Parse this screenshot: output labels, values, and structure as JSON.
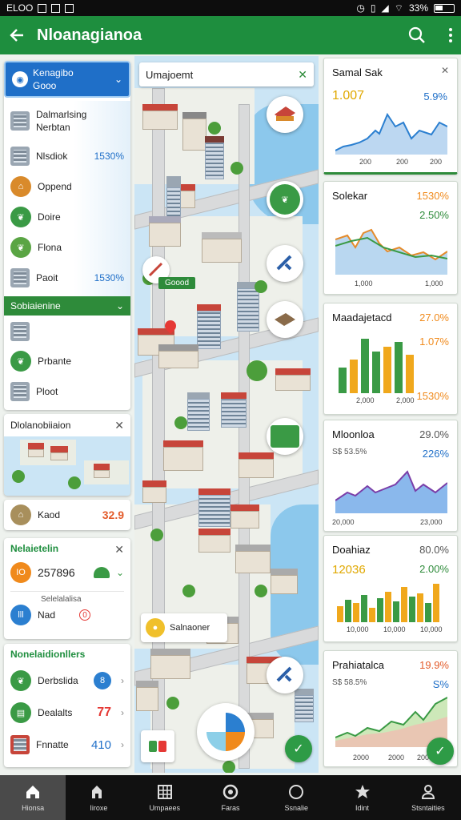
{
  "status_bar": {
    "left_text": "ELOO",
    "battery": "33%"
  },
  "app_bar": {
    "title": "Nloanagianoa"
  },
  "left": {
    "dropdown": {
      "line1": "Kenagibo",
      "line2": "Gooo"
    },
    "list1": [
      {
        "icon": "building-icon",
        "label": "Dalmarlsing\nNerbtan",
        "value": ""
      },
      {
        "icon": "building-icon",
        "label": "Nlsdiok",
        "value": "1530%"
      },
      {
        "icon": "temple-icon",
        "label": "Oppend",
        "value": ""
      },
      {
        "icon": "leaf-icon",
        "label": "Doire",
        "value": ""
      },
      {
        "icon": "leaf-icon",
        "label": "Flona",
        "value": ""
      },
      {
        "icon": "building-icon",
        "label": "Paoit",
        "value": "1530%"
      }
    ],
    "section2_title": "Sobiaienine",
    "list2": [
      {
        "icon": "building-icon",
        "label": ""
      },
      {
        "icon": "leaf-icon",
        "label": "Prbante"
      },
      {
        "icon": "building-icon",
        "label": "Ploot"
      }
    ],
    "map_card_title": "Dlolanobiiaion",
    "kaod": {
      "label": "Kaod",
      "value": "32.9"
    },
    "stats_card": {
      "title": "Nelaietelin",
      "row1_badge": "IO",
      "row1_value": "257896",
      "row2_label": "Selelalalisa",
      "row2_badge": "lll",
      "row2_text": "Nad",
      "row2_value": "0"
    },
    "bottom_card": {
      "title": "Nonelaidionllers",
      "rows": [
        {
          "label": "Derbslida",
          "value": "8"
        },
        {
          "label": "Dealalts",
          "value": "77"
        },
        {
          "label": "Fnnatte",
          "value": "410"
        }
      ]
    }
  },
  "map": {
    "search_text": "Umajoemt",
    "callout1": "Goood",
    "callout2": "Salnaoner"
  },
  "right": {
    "cards": [
      {
        "title": "Samal Sak",
        "main": "1.007",
        "pct": "5.9%",
        "x1": "200",
        "x2": "200",
        "x3": "200"
      },
      {
        "title": "Solekar",
        "pct1": "1530%",
        "pct2": "2.50%",
        "x1": "1,000",
        "x2": "1,000"
      },
      {
        "title": "Maadajetacd",
        "pct1": "27.0%",
        "pct2": "1.07%",
        "pct3": "1530%",
        "x1": "2,000",
        "x2": "2,000"
      },
      {
        "title": "Mloonloa",
        "sub": "S$ 53.5%",
        "pct1": "29.0%",
        "pct2": "226%",
        "x1": "20,000",
        "x2": "23,000"
      },
      {
        "title": "Doahiaz",
        "main": "12036",
        "pct1": "80.0%",
        "pct2": "2.00%",
        "x1": "10,000",
        "x2": "10,000",
        "x3": "10,000"
      },
      {
        "title": "Prahiatalca",
        "sub": "S$ 58.5%",
        "pct1": "19.9%",
        "pct2": "S%",
        "x1": "2000",
        "x2": "2000",
        "x3": "2000"
      }
    ]
  },
  "bottom_nav": [
    {
      "icon": "home-icon",
      "label": "Hionsa"
    },
    {
      "icon": "chart-icon",
      "label": "Iiroxe"
    },
    {
      "icon": "grid-icon",
      "label": "Umpaees"
    },
    {
      "icon": "target-icon",
      "label": "Faras"
    },
    {
      "icon": "circle-icon",
      "label": "Ssnalie"
    },
    {
      "icon": "star-icon",
      "label": "Idint"
    },
    {
      "icon": "person-icon",
      "label": "Stsntaities"
    }
  ]
}
